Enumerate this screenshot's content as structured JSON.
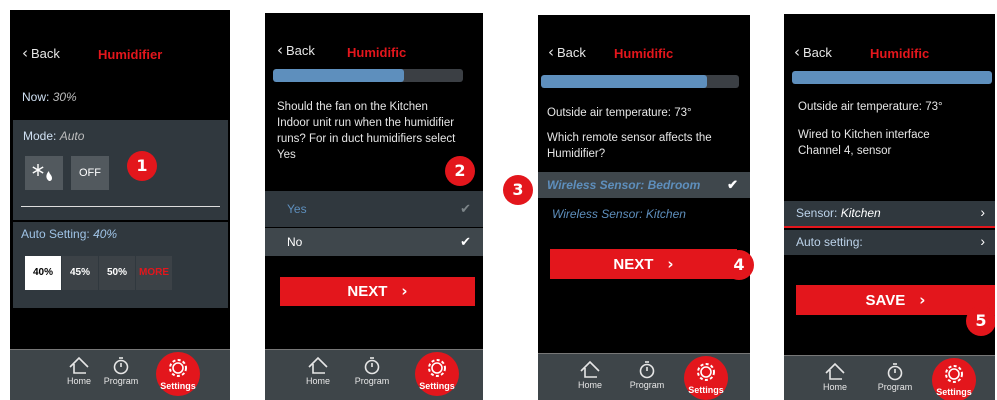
{
  "screens": [
    {
      "back": "Back",
      "title": "Humidifier",
      "now_label": "Now:",
      "now_value": "30%",
      "mode_label": "Mode:",
      "mode_value": "Auto",
      "off_label": "OFF",
      "auto_setting_label": "Auto Setting:",
      "auto_setting_value": "40%",
      "options": [
        "40%",
        "45%",
        "50%",
        "MORE"
      ],
      "badge": "1"
    },
    {
      "back": "Back",
      "title": "Humidific",
      "progress": 0.69,
      "question": "Should the fan on the Kitchen Indoor unit run when the humidifier runs? For in duct humidifiers select Yes",
      "yes": "Yes",
      "no": "No",
      "next": "NEXT",
      "badge": "2"
    },
    {
      "back": "Back",
      "title": "Humidific",
      "progress": 0.84,
      "outside_label": "Outside air temperature:",
      "outside_value": "73°",
      "question": "Which remote sensor affects the Humidifier?",
      "sensor_bedroom": "Wireless Sensor: Bedroom",
      "sensor_kitchen": "Wireless Sensor: Kitchen",
      "next": "NEXT",
      "badge_a": "3",
      "badge_b": "4"
    },
    {
      "back": "Back",
      "title": "Humidific",
      "progress": 1.0,
      "outside_label": "Outside air temperature:",
      "outside_value": "73°",
      "wired_text": "Wired to Kitchen interface Channel 4, sensor",
      "sensor_label": "Sensor:",
      "sensor_value": "Kitchen",
      "auto_setting_label": "Auto setting:",
      "save": "SAVE",
      "badge": "5"
    }
  ],
  "tabs": {
    "home": "Home",
    "program": "Program",
    "settings": "Settings"
  },
  "colors": {
    "accent": "#e3161c",
    "progress": "#5e8fbd",
    "panel": "#30383e",
    "tabbar": "#3e4549"
  },
  "icons": [
    "chevron-left-icon",
    "snowflake-flame-icon",
    "check-icon",
    "chevron-right-icon",
    "home-icon",
    "stopwatch-icon",
    "gear-icon"
  ]
}
